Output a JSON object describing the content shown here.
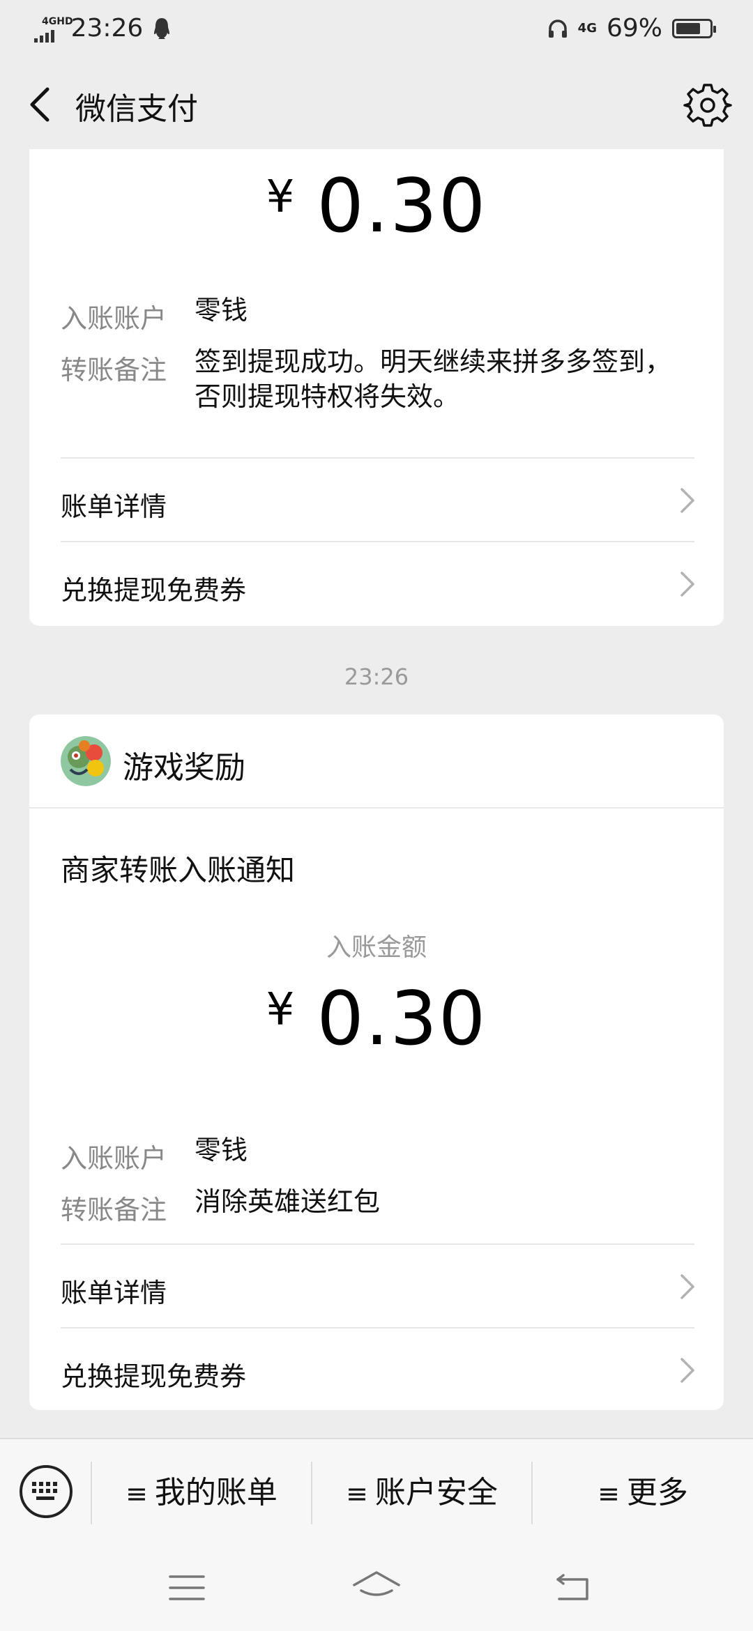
{
  "status": {
    "network": "4GHD",
    "time": "23:26",
    "network2": "4G",
    "battery": "69%",
    "battery_level": 0.69
  },
  "header": {
    "title": "微信支付"
  },
  "card1": {
    "currency": "¥",
    "amount": "0.30",
    "account_label": "入账账户",
    "account_value": "零钱",
    "note_label": "转账备注",
    "note_value": "签到提现成功。明天继续来拼多多签到，否则提现特权将失效。",
    "link1": "账单详情",
    "link2": "兑换提现免费券"
  },
  "time_separator": "23:26",
  "card2": {
    "merchant": "游戏奖励",
    "notice_title": "商家转账入账通知",
    "amount_caption": "入账金额",
    "currency": "¥",
    "amount": "0.30",
    "account_label": "入账账户",
    "account_value": "零钱",
    "note_label": "转账备注",
    "note_value": "消除英雄送红包",
    "link1": "账单详情",
    "link2": "兑换提现免费券"
  },
  "menu": {
    "item1": "我的账单",
    "item2": "账户安全",
    "item3": "更多"
  }
}
